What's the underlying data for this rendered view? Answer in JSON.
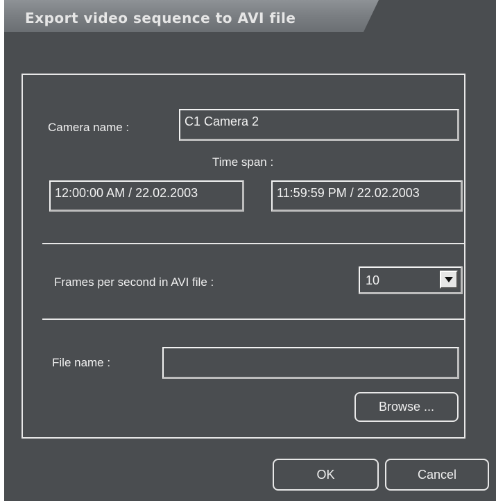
{
  "window": {
    "title": "Export video sequence to AVI file"
  },
  "camera": {
    "label": "Camera name :",
    "value": "C1 Camera 2"
  },
  "time_span": {
    "label": "Time span  :",
    "start": "12:00:00 AM / 22.02.2003",
    "end": "11:59:59 PM / 22.02.2003"
  },
  "fps": {
    "label": "Frames per second in AVI file :",
    "selected": "10"
  },
  "file": {
    "label": "File name :",
    "value": "",
    "browse_label": "Browse ..."
  },
  "buttons": {
    "ok_label": "OK",
    "cancel_label": "Cancel"
  },
  "colors": {
    "background": "#4a4d50",
    "title_tab": "#7a7e82",
    "text": "#f0f0f0",
    "border_light": "#f2f2f2"
  },
  "icons": {
    "dropdown": "chevron-down-icon"
  }
}
